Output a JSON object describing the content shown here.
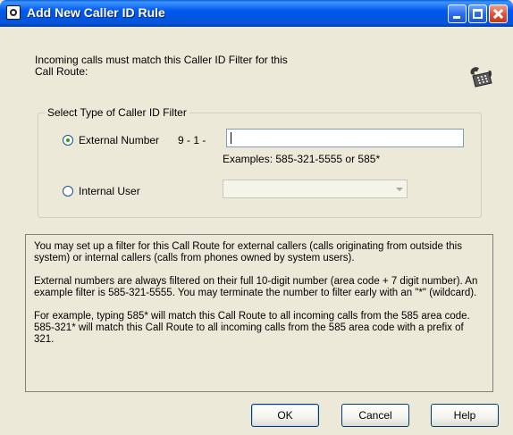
{
  "window": {
    "title": "Add New Caller ID Rule"
  },
  "intro_text": "Incoming calls must match this Caller ID Filter for this Call Route:",
  "filter_group": {
    "legend": "Select Type of Caller ID Filter",
    "external": {
      "label": "External Number",
      "selected": true,
      "prefix": "9 - 1 -",
      "value": "",
      "examples": "Examples: 585-321-5555 or 585*"
    },
    "internal": {
      "label": "Internal User",
      "selected": false,
      "selected_value": ""
    }
  },
  "info": {
    "paragraph_1": "You may set up a filter for this Call Route for external callers (calls originating from outside this system) or internal callers (calls from phones owned by system users).",
    "paragraph_2": "External numbers are always filtered on their full 10-digit number (area code + 7 digit number). An example filter is 585-321-5555. You may terminate the number to filter early with an \"*\" (wildcard).",
    "paragraph_3": "For example, typing 585* will match this Call Route to all incoming calls from the 585 area code. 585-321* will match this Call Route to all incoming calls from the 585 area code with a prefix of 321."
  },
  "buttons": {
    "ok": "OK",
    "cancel": "Cancel",
    "help": "Help"
  },
  "icons": {
    "app": "app-logo-icon",
    "phone": "telephone-icon"
  }
}
